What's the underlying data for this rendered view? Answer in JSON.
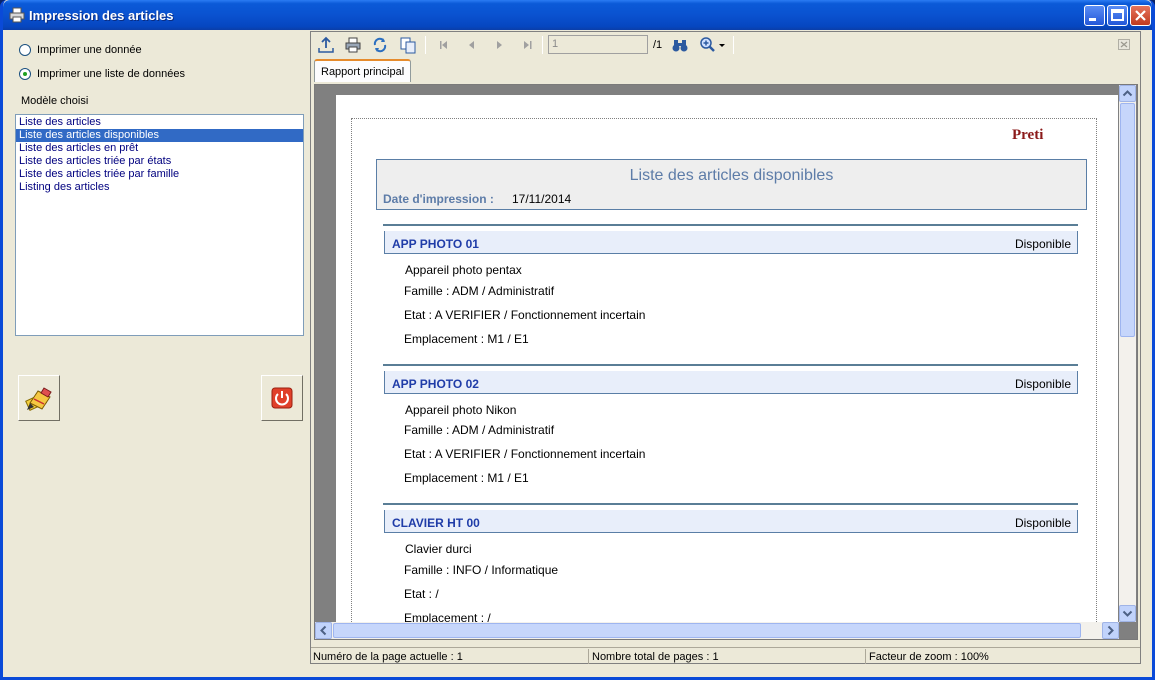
{
  "window": {
    "title": "Impression des articles"
  },
  "left": {
    "radio_single": "Imprimer une donnée",
    "radio_list": "Imprimer une liste de données",
    "selected_radio": "radio_list",
    "model_label": "Modèle choisi",
    "models": [
      "Liste des articles",
      "Liste des articles disponibles",
      "Liste des articles en prêt",
      "Liste des articles triée par états",
      "Liste des articles triée par famille",
      "Listing des articles"
    ],
    "selected_model_index": 1
  },
  "toolbar": {
    "page_input": "1",
    "page_total": "/1",
    "icons": [
      "export-icon",
      "print-icon",
      "refresh-icon",
      "copy-icon",
      "first-page-icon",
      "prev-page-icon",
      "next-page-icon",
      "last-page-icon",
      "binoculars-icon",
      "zoom-icon",
      "close-icon"
    ]
  },
  "tabs": {
    "main": "Rapport principal"
  },
  "report": {
    "logo": "Preti",
    "title": "Liste des articles disponibles",
    "print_date_label": "Date d'impression :",
    "print_date_value": "17/11/2014",
    "articles": [
      {
        "code": "APP PHOTO 01",
        "status": "Disponible",
        "description": "Appareil photo pentax",
        "famille": "Famille : ADM / Administratif",
        "etat": "Etat : A VERIFIER / Fonctionnement incertain",
        "emplacement": "Emplacement : M1 / E1"
      },
      {
        "code": "APP PHOTO 02",
        "status": "Disponible",
        "description": "Appareil photo Nikon",
        "famille": "Famille : ADM / Administratif",
        "etat": "Etat : A VERIFIER / Fonctionnement incertain",
        "emplacement": "Emplacement : M1 / E1"
      },
      {
        "code": "CLAVIER HT 00",
        "status": "Disponible",
        "description": "Clavier durci",
        "famille": "Famille : INFO / Informatique",
        "etat": "Etat :  /",
        "emplacement": "Emplacement :  /"
      }
    ]
  },
  "statusbar": {
    "current_page": "Numéro de la page actuelle : 1",
    "total_pages": "Nombre total de pages : 1",
    "zoom": "Facteur de zoom : 100%"
  },
  "colors": {
    "title_bar": "#0a52d0",
    "selection": "#316ac5",
    "report_title": "#5d7ca8",
    "article_code": "#1f3ca8",
    "logo": "#8b1a1a"
  }
}
